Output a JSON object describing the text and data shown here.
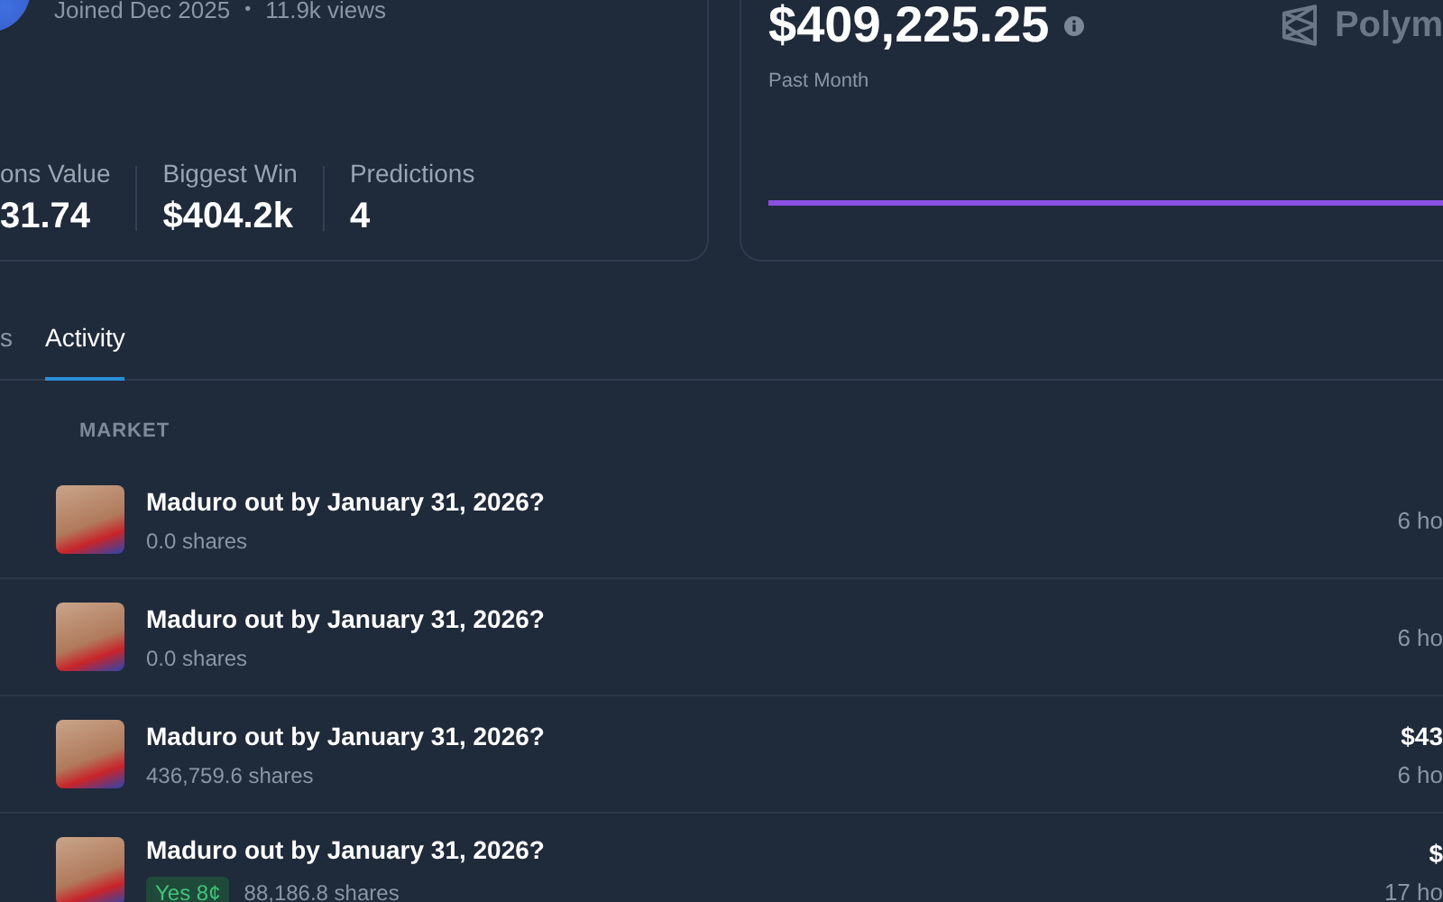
{
  "profile": {
    "joined": "Joined Dec 2025",
    "separator": "•",
    "views": "11.9k views"
  },
  "stats": [
    {
      "label": "ons Value",
      "value": "31.74"
    },
    {
      "label": "Biggest Win",
      "value": "$404.2k"
    },
    {
      "label": "Predictions",
      "value": "4"
    }
  ],
  "pnl": {
    "amount": "$409,225.25",
    "period": "Past Month",
    "brand": "Polym"
  },
  "tabs": [
    {
      "label": "s",
      "selected": false
    },
    {
      "label": "Activity",
      "selected": true
    }
  ],
  "table": {
    "columns": [
      "MARKET"
    ],
    "rows": [
      {
        "title": "Maduro out by January 31, 2026?",
        "shares": "0.0 shares",
        "time": "6 ho"
      },
      {
        "title": "Maduro out by January 31, 2026?",
        "shares": "0.0 shares",
        "time": "6 ho"
      },
      {
        "title": "Maduro out by January 31, 2026?",
        "shares": "436,759.6 shares",
        "value": "$43",
        "time": "6 ho"
      },
      {
        "title": "Maduro out by January 31, 2026?",
        "outcome": "Yes 8¢",
        "shares": "88,186.8 shares",
        "value": "$",
        "time": "17 ho"
      }
    ]
  }
}
